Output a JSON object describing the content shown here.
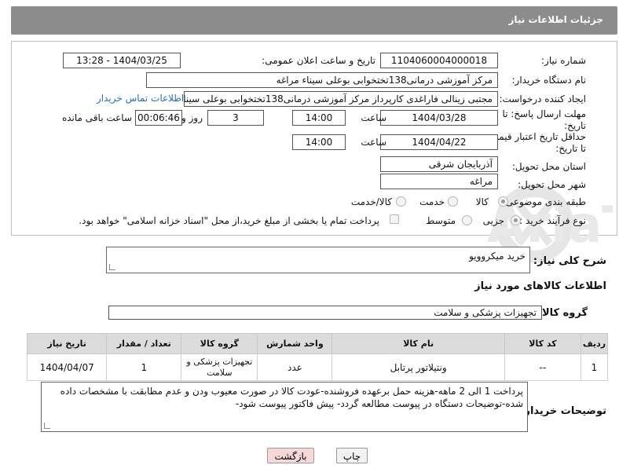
{
  "header": {
    "title": "جزئیات اطلاعات نیاز"
  },
  "form": {
    "need_number_label": "شماره نیاز:",
    "need_number": "1104060004000018",
    "announce_label": "تاریخ و ساعت اعلان عمومی:",
    "announce_value": "1404/03/25 - 13:28",
    "buyer_org_label": "نام دستگاه خریدار:",
    "buyer_org": "مرکز آموزشی درمانی138تختخوابی بوعلی سیناء مراغه",
    "requester_label": "ایجاد کننده درخواست:",
    "requester": "مجتبی زینالی فاراغدی کارپرداز مرکز آموزشی درمانی138تختخوابی بوعلی سینا",
    "contact_link": "اطلاعات تماس خریدار",
    "deadline_label_1": "مهلت ارسال پاسخ: تا",
    "deadline_label_2": "تاریخ:",
    "deadline_date": "1404/03/28",
    "time_word": "ساعت",
    "deadline_time": "14:00",
    "days_value": "3",
    "days_and_label": "روز و",
    "remaining_time": "00:06:46",
    "remaining_label": "ساعت باقی مانده",
    "validity_label_1": "حداقل تاریخ اعتبار قیمت:",
    "validity_label_2": "تا تاریخ:",
    "validity_date": "1404/04/22",
    "validity_time": "14:00",
    "province_label": "استان محل تحویل:",
    "province": "آذربایجان شرقی",
    "city_label": "شهر محل تحویل:",
    "city": "مراغه",
    "category_label": "طبقه بندی موضوعی:",
    "category_options": [
      "کالا",
      "خدمت",
      "کالا/خدمت"
    ],
    "process_label": "نوع فرآیند خرید :",
    "process_options": [
      "جزیی",
      "متوسط"
    ],
    "treasury_note": "پرداخت تمام یا بخشی از مبلغ خرید،از محل \"اسناد خزانه اسلامی\" خواهد بود."
  },
  "description": {
    "label": "شرح کلی نیاز:",
    "value": "خرید میکروویو"
  },
  "goods": {
    "section_title": "اطلاعات کالاهای مورد نیاز",
    "group_label": "گروه کالا:",
    "group_value": "تجهیزات پزشکی و سلامت",
    "columns": [
      "ردیف",
      "کد کالا",
      "نام کالا",
      "واحد شمارش",
      "گروه کالا",
      "تعداد / مقدار",
      "تاریخ نیاز"
    ],
    "rows": [
      [
        "1",
        "--",
        "ونتیلاتور پرتابل",
        "عدد",
        "تجهیزات پزشکی و سلامت",
        "1",
        "1404/04/07"
      ]
    ]
  },
  "buyer_notes": {
    "label": "توضیحات خریدار:",
    "value": "پرداخت 1 الی 2 ماهه-هزینه حمل برعهده فروشنده-عودت کالا در صورت معیوب ودن و عدم مطابقت با مشخصات داده شده-توضیحات دستگاه در پیوست مطالعه گردد- پیش فاکتور پیوست شود-"
  },
  "buttons": {
    "print": "چاپ",
    "back": "بازگشت"
  },
  "colors": {
    "titlebar": "#8c8c8c",
    "link": "#1f6fbf",
    "back_button": "#f7d8d8",
    "print_button": "#f2f2f2"
  },
  "watermark": {
    "text": "AriaTender.net"
  }
}
